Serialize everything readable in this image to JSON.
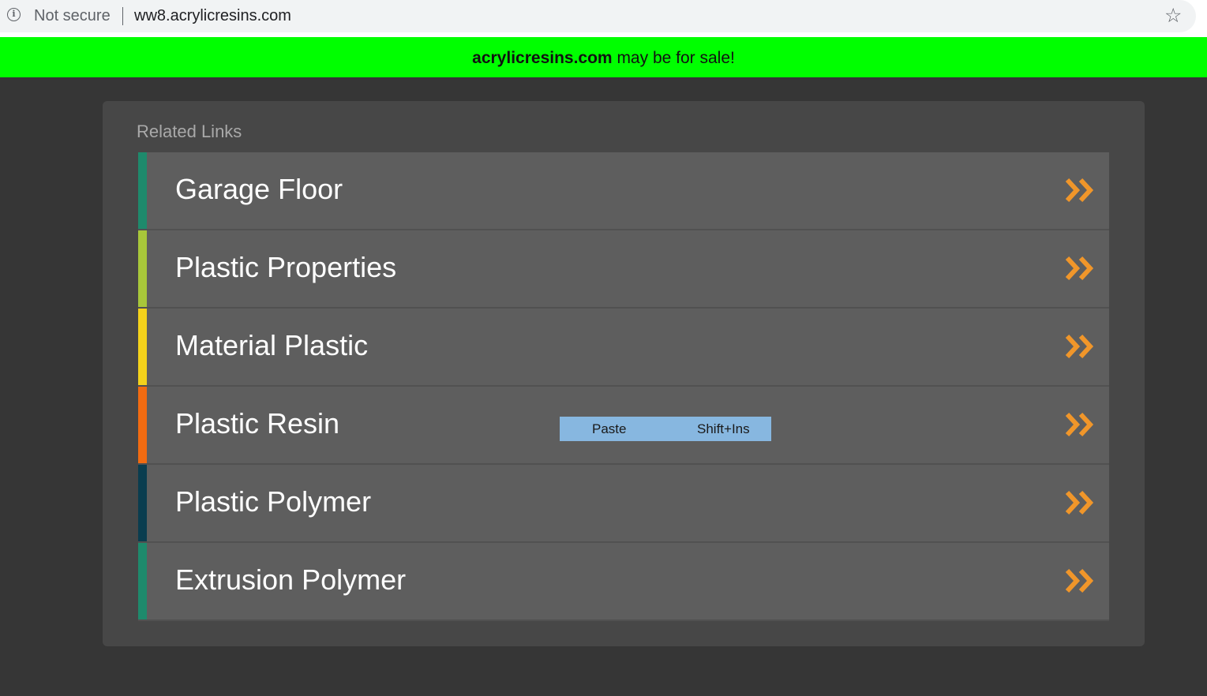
{
  "browser": {
    "security_text": "Not secure",
    "url": "ww8.acrylicresins.com"
  },
  "banner": {
    "domain": "acrylicresins.com",
    "message": " may be for sale!",
    "color": "#00ff00"
  },
  "panel": {
    "title": "Related Links",
    "links": [
      {
        "label": "Garage Floor",
        "accent": "#1e8a6c"
      },
      {
        "label": "Plastic Properties",
        "accent": "#a8c73a"
      },
      {
        "label": "Material Plastic",
        "accent": "#f4d21b"
      },
      {
        "label": "Plastic Resin",
        "accent": "#f26b11"
      },
      {
        "label": "Plastic Polymer",
        "accent": "#0a3d4f"
      },
      {
        "label": "Extrusion Polymer",
        "accent": "#1e8a6c"
      }
    ],
    "chevron_color": "#f0962a"
  },
  "context_menu": {
    "item_label": "Paste",
    "item_shortcut": "Shift+Ins"
  }
}
